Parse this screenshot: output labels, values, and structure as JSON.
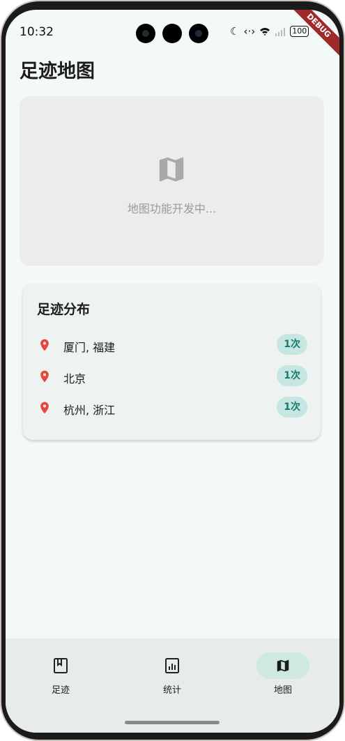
{
  "status_bar": {
    "time": "10:32",
    "battery": "100"
  },
  "debug_banner": "DEBUG",
  "header": {
    "title": "足迹地图"
  },
  "map": {
    "placeholder_text": "地图功能开发中...",
    "icon": "map-icon"
  },
  "distribution": {
    "title": "足迹分布",
    "items": [
      {
        "place": "厦门, 福建",
        "count": "1次",
        "icon": "location-pin-icon"
      },
      {
        "place": "北京",
        "count": "1次",
        "icon": "location-pin-icon"
      },
      {
        "place": "杭州, 浙江",
        "count": "1次",
        "icon": "location-pin-icon"
      }
    ]
  },
  "bottom_nav": {
    "items": [
      {
        "label": "足迹",
        "icon": "book-icon",
        "active": false
      },
      {
        "label": "统计",
        "icon": "chart-icon",
        "active": false
      },
      {
        "label": "地图",
        "icon": "map-icon",
        "active": true
      }
    ]
  },
  "colors": {
    "background": "#f3f9f7",
    "accent": "#187a6e",
    "badge_bg": "#c6e7e1",
    "pin": "#e8453c"
  }
}
